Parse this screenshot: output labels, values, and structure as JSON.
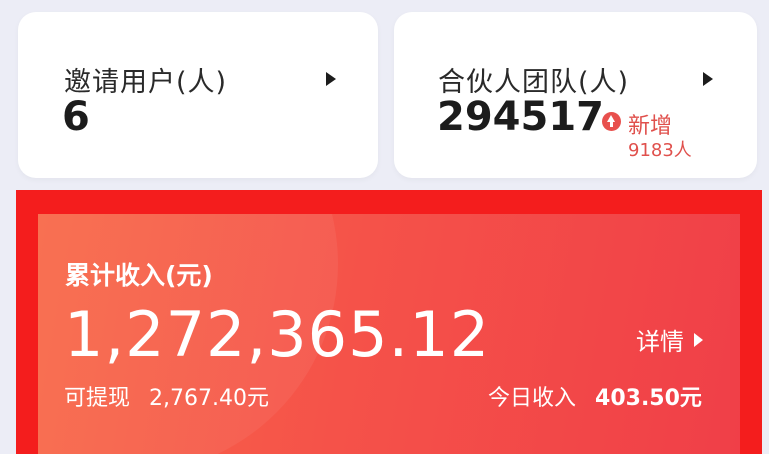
{
  "invited_users": {
    "label": "邀请用户(人)",
    "value": "6"
  },
  "partner_team": {
    "label": "合伙人团队(人)",
    "value": "294517",
    "new_label": "新增",
    "new_count": "9183人"
  },
  "income": {
    "title": "累计收入(元)",
    "total": "1,272,365.12",
    "detail_label": "详情",
    "withdrawable_label": "可提现",
    "withdrawable_value": "2,767.40元",
    "today_label": "今日收入",
    "today_value": "403.50元"
  },
  "colors": {
    "highlight_frame": "#f41d1d",
    "income_gradient_start": "#f86848",
    "income_gradient_end": "#f03f48",
    "new_badge": "#e8504d"
  },
  "icons": {
    "card_arrow": "triangle-right-icon",
    "new_badge": "arrow-up-circle-icon"
  }
}
